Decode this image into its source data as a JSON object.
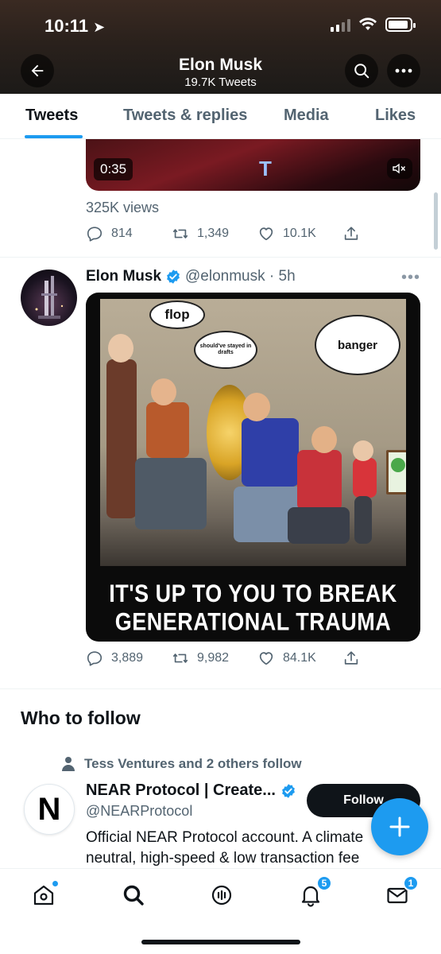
{
  "status_bar": {
    "time": "10:11"
  },
  "header": {
    "title": "Elon Musk",
    "subtitle": "19.7K Tweets"
  },
  "tabs": [
    {
      "label": "Tweets",
      "active": true
    },
    {
      "label": "Tweets & replies",
      "active": false
    },
    {
      "label": "Media",
      "active": false
    },
    {
      "label": "Likes",
      "active": false
    }
  ],
  "tweet1": {
    "video_duration": "0:35",
    "views": "325K views",
    "replies": "814",
    "retweets": "1,349",
    "likes": "10.1K"
  },
  "tweet2": {
    "author_name": "Elon Musk",
    "meta": "@elonmusk · 5h",
    "meme": {
      "bubble_flop": "flop",
      "bubble_drafts": "should've stayed in drafts",
      "bubble_banger": "banger",
      "caption_line1": "IT'S UP TO YOU TO BREAK",
      "caption_line2": "GENERATIONAL TRAUMA"
    },
    "replies": "3,889",
    "retweets": "9,982",
    "likes": "84.1K"
  },
  "who_to_follow": {
    "title": "Who to follow",
    "social_context": "Tess Ventures and 2 others follow",
    "name": "NEAR Protocol | Create...",
    "handle": "@NEARProtocol",
    "follow_label": "Follow",
    "bio": "Official NEAR Protocol account. A climate neutral, high-speed & low transaction fee",
    "avatar_glyph": "N"
  },
  "bottom_nav": {
    "notifications_badge": "5",
    "messages_badge": "1"
  },
  "colors": {
    "accent": "#1d9bf0",
    "text": "#0f1419",
    "secondary": "#536471"
  }
}
